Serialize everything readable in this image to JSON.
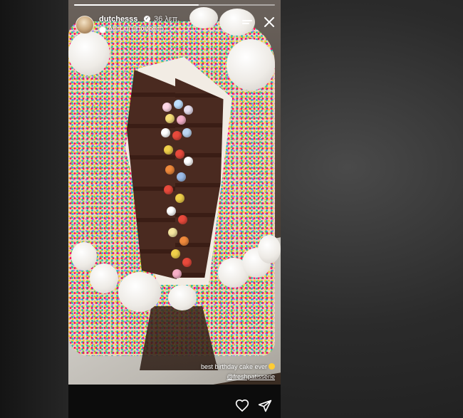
{
  "story": {
    "username": "dutchesss_",
    "time_ago": "36 λεπ.",
    "translate_label": "Δείτε τη μετάφραση",
    "caption_line1": "best birthday cake ever",
    "caption_mention": "@freshpatisserie",
    "progress": 0.62
  },
  "icons": {
    "verified": "verified-badge-icon",
    "menu": "menu-icon",
    "close": "close-icon",
    "heart": "heart-icon",
    "send": "send-icon",
    "emoji": "smile-emoji-icon"
  },
  "colors": {
    "background": "#2b2b2b",
    "story_bar": "#0c0c0c",
    "text": "#ffffff"
  }
}
